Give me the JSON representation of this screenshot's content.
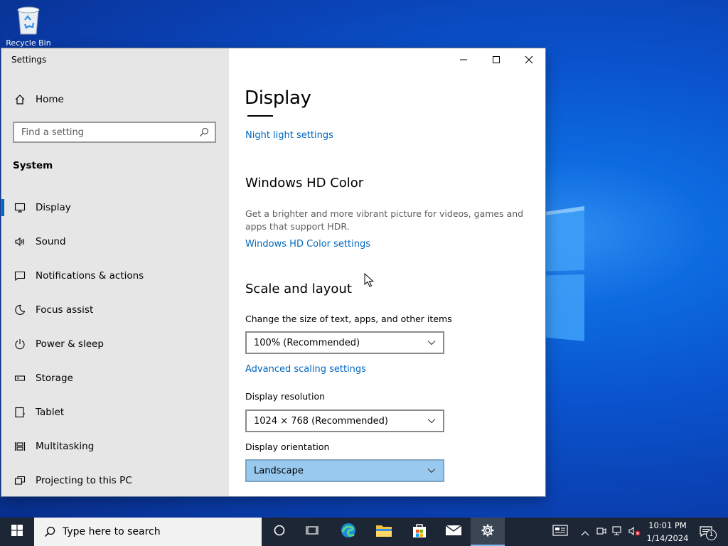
{
  "desktop": {
    "recycle_bin_label": "Recycle Bin"
  },
  "window": {
    "app_title": "Settings",
    "controls": {
      "minimize_icon": "minimize-icon",
      "maximize_icon": "maximize-icon",
      "close_icon": "close-icon"
    }
  },
  "sidebar": {
    "home_label": "Home",
    "search_placeholder": "Find a setting",
    "section_label": "System",
    "items": [
      {
        "label": "Display",
        "icon": "monitor-icon",
        "selected": true
      },
      {
        "label": "Sound",
        "icon": "speaker-icon"
      },
      {
        "label": "Notifications & actions",
        "icon": "message-icon"
      },
      {
        "label": "Focus assist",
        "icon": "moon-icon"
      },
      {
        "label": "Power & sleep",
        "icon": "power-icon"
      },
      {
        "label": "Storage",
        "icon": "storage-icon"
      },
      {
        "label": "Tablet",
        "icon": "tablet-icon"
      },
      {
        "label": "Multitasking",
        "icon": "multitasking-icon"
      },
      {
        "label": "Projecting to this PC",
        "icon": "projecting-icon"
      }
    ]
  },
  "content": {
    "page_title": "Display",
    "night_light_link": "Night light settings",
    "hd_color": {
      "heading": "Windows HD Color",
      "description": "Get a brighter and more vibrant picture for videos, games and apps that support HDR.",
      "link": "Windows HD Color settings"
    },
    "scale_layout": {
      "heading": "Scale and layout",
      "scale_label": "Change the size of text, apps, and other items",
      "scale_value": "100% (Recommended)",
      "advanced_link": "Advanced scaling settings",
      "resolution_label": "Display resolution",
      "resolution_value": "1024 × 768 (Recommended)",
      "orientation_label": "Display orientation",
      "orientation_value": "Landscape"
    }
  },
  "taskbar": {
    "search_placeholder": "Type here to search",
    "time": "10:01 PM",
    "date": "1/14/2024",
    "notification_count": "1"
  },
  "colors": {
    "accent": "#0067c0",
    "sidebar_bg": "#e6e6e6",
    "taskbar_bg": "#1c2634",
    "highlight_dropdown": "#99c9ef"
  }
}
